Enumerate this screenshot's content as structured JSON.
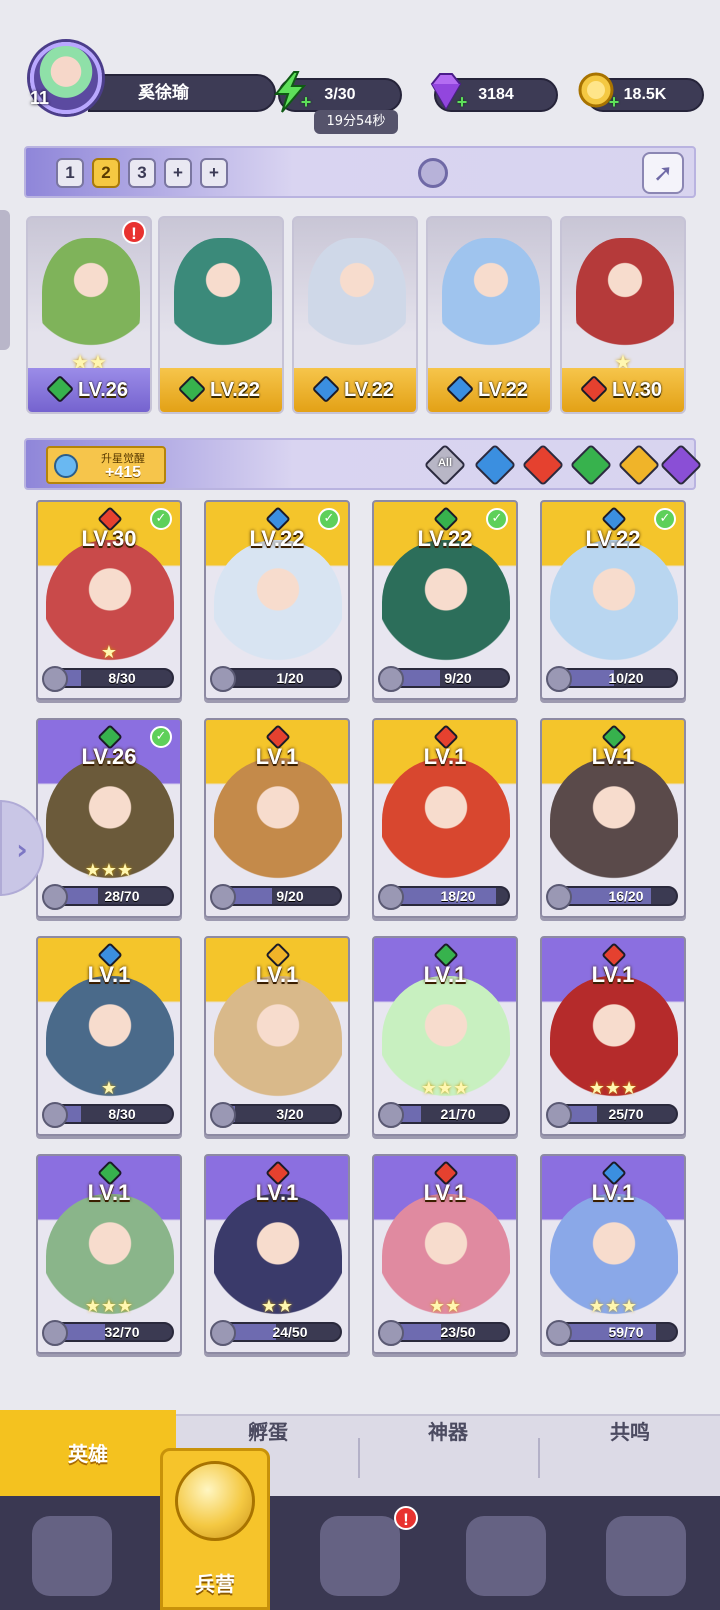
{
  "player": {
    "level": "11",
    "name": "奚徐瑜"
  },
  "resources": {
    "energy": {
      "value": "3/30",
      "timer": "19分54秒"
    },
    "gems": {
      "value": "3184"
    },
    "gold": {
      "value": "18.5K"
    }
  },
  "team_tabs": [
    "1",
    "2",
    "3",
    "+",
    "+"
  ],
  "team_active": "2",
  "team_slots": [
    {
      "level": "LV.26",
      "element": "wind",
      "stars": "★★",
      "alert": "!"
    },
    {
      "level": "LV.22",
      "element": "wind",
      "stars": ""
    },
    {
      "level": "LV.22",
      "element": "water",
      "stars": ""
    },
    {
      "level": "LV.22",
      "element": "water",
      "stars": ""
    },
    {
      "level": "LV.30",
      "element": "fire",
      "stars": "★"
    }
  ],
  "filter": {
    "star_awaken_label": "升星觉醒",
    "star_awaken_value": "+415",
    "buttons": [
      "All",
      "water",
      "fire",
      "wind",
      "light",
      "dark"
    ]
  },
  "heroes": [
    {
      "level": "LV.30",
      "element": "fire",
      "progress": "8/30",
      "fill": 0.27,
      "stars": "★",
      "checked": true,
      "rarity": "gold"
    },
    {
      "level": "LV.22",
      "element": "water",
      "progress": "1/20",
      "fill": 0.05,
      "stars": "",
      "checked": true,
      "rarity": "gold"
    },
    {
      "level": "LV.22",
      "element": "wind",
      "progress": "9/20",
      "fill": 0.45,
      "stars": "",
      "checked": true,
      "rarity": "gold"
    },
    {
      "level": "LV.22",
      "element": "water",
      "progress": "10/20",
      "fill": 0.5,
      "stars": "",
      "checked": true,
      "rarity": "gold"
    },
    {
      "level": "LV.26",
      "element": "wind",
      "progress": "28/70",
      "fill": 0.4,
      "stars": "★★★",
      "checked": true,
      "rarity": "purple"
    },
    {
      "level": "LV.1",
      "element": "fire",
      "progress": "9/20",
      "fill": 0.45,
      "stars": "",
      "checked": false,
      "rarity": "gold"
    },
    {
      "level": "LV.1",
      "element": "fire",
      "progress": "18/20",
      "fill": 0.9,
      "stars": "",
      "checked": false,
      "rarity": "gold"
    },
    {
      "level": "LV.1",
      "element": "wind",
      "progress": "16/20",
      "fill": 0.8,
      "stars": "",
      "checked": false,
      "rarity": "gold"
    },
    {
      "level": "LV.1",
      "element": "water",
      "progress": "8/30",
      "fill": 0.27,
      "stars": "★",
      "checked": false,
      "rarity": "gold"
    },
    {
      "level": "LV.1",
      "element": "light",
      "progress": "3/20",
      "fill": 0.15,
      "stars": "",
      "checked": false,
      "rarity": "gold"
    },
    {
      "level": "LV.1",
      "element": "wind",
      "progress": "21/70",
      "fill": 0.3,
      "stars": "★★★",
      "checked": false,
      "rarity": "purple"
    },
    {
      "level": "LV.1",
      "element": "fire",
      "progress": "25/70",
      "fill": 0.36,
      "stars": "★★★",
      "checked": false,
      "rarity": "purple"
    },
    {
      "level": "LV.1",
      "element": "wind",
      "progress": "32/70",
      "fill": 0.46,
      "stars": "★★★",
      "checked": false,
      "rarity": "purple"
    },
    {
      "level": "LV.1",
      "element": "fire",
      "progress": "24/50",
      "fill": 0.48,
      "stars": "★★",
      "checked": false,
      "rarity": "purple"
    },
    {
      "level": "LV.1",
      "element": "fire",
      "progress": "23/50",
      "fill": 0.46,
      "stars": "★★",
      "checked": false,
      "rarity": "purple"
    },
    {
      "level": "LV.1",
      "element": "water",
      "progress": "59/70",
      "fill": 0.84,
      "stars": "★★★",
      "checked": false,
      "rarity": "purple"
    }
  ],
  "subtabs": [
    "英雄",
    "孵蛋",
    "神器",
    "共鸣"
  ],
  "subtab_active": "英雄",
  "nav": {
    "active_label": "兵营",
    "alert": "!"
  },
  "colors": {
    "fire": "#e5412f",
    "water": "#3b8fe0",
    "wind": "#37b24d",
    "light": "#f0b429",
    "dark": "#8a4fd6",
    "gold_card": "#f4c52b",
    "purple_card": "#8b6fe0",
    "accent": "#f4c21f"
  },
  "icons": {
    "energy": "lightning-icon",
    "gems": "diamond-icon",
    "gold": "coin-icon",
    "search": "magnifier-icon",
    "share": "share-icon",
    "shard": "soul-shard-icon"
  }
}
